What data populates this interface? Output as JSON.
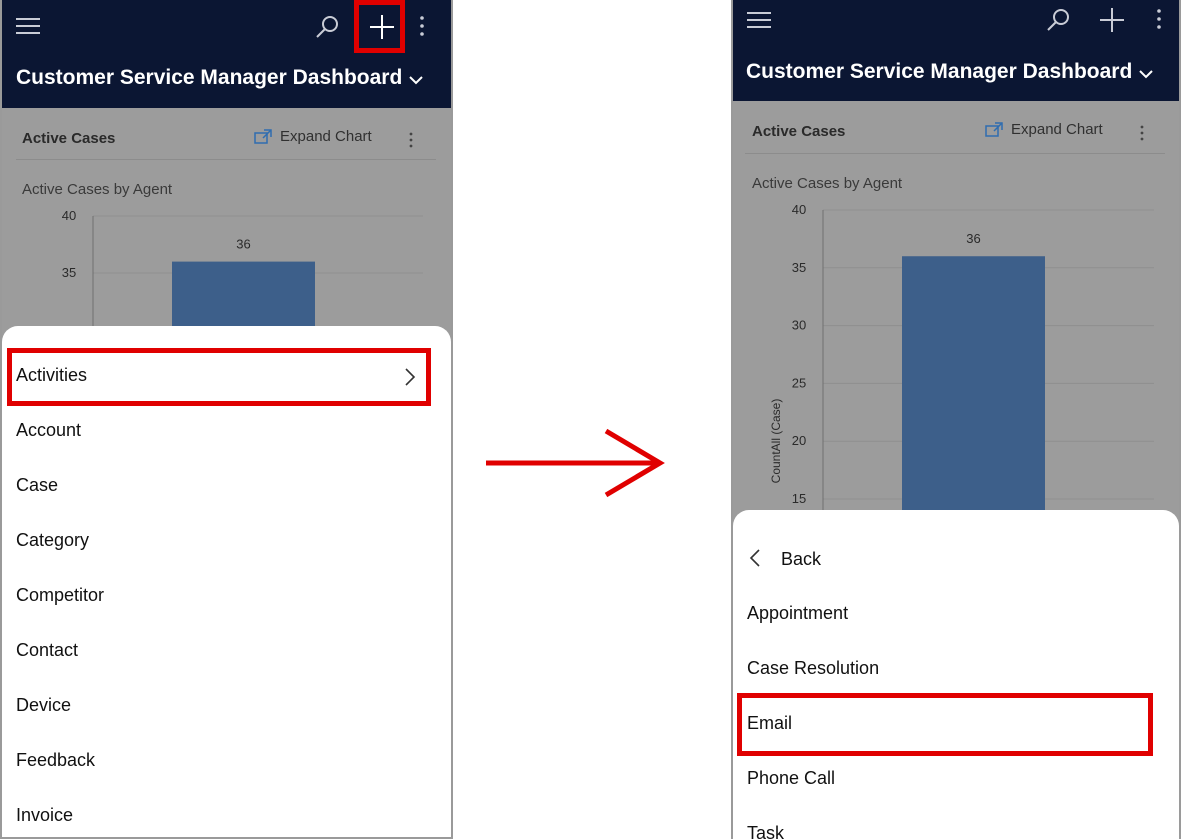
{
  "left_screen": {
    "dashboard_title": "Customer Service Manager Dashboard",
    "card_title": "Active Cases",
    "expand_chart_label": "Expand Chart",
    "chart_caption": "Active Cases by Agent",
    "menu": {
      "items": [
        {
          "label": "Activities",
          "has_submenu": true
        },
        {
          "label": "Account"
        },
        {
          "label": "Case"
        },
        {
          "label": "Category"
        },
        {
          "label": "Competitor"
        },
        {
          "label": "Contact"
        },
        {
          "label": "Device"
        },
        {
          "label": "Feedback"
        },
        {
          "label": "Invoice"
        }
      ]
    },
    "chart_data": {
      "type": "bar",
      "categories": [
        ""
      ],
      "values": [
        36
      ],
      "ylim": [
        33,
        40
      ],
      "yticks": [
        "35",
        "40"
      ],
      "data_labels": [
        "36"
      ],
      "bar_color": "#3d5f8a"
    }
  },
  "right_screen": {
    "dashboard_title": "Customer Service Manager Dashboard",
    "card_title": "Active Cases",
    "expand_chart_label": "Expand Chart",
    "chart_caption": "Active Cases by Agent",
    "menu": {
      "back_label": "Back",
      "items": [
        {
          "label": "Appointment"
        },
        {
          "label": "Case Resolution"
        },
        {
          "label": "Email"
        },
        {
          "label": "Phone Call"
        },
        {
          "label": "Task"
        }
      ]
    },
    "chart_data": {
      "type": "bar",
      "categories": [
        ""
      ],
      "values": [
        36
      ],
      "ylim": [
        14,
        40
      ],
      "yticks": [
        "40",
        "35",
        "30",
        "25",
        "20",
        "15"
      ],
      "ylabel": "CountAll (Case)",
      "data_labels": [
        "36"
      ],
      "bar_color": "#3d5f8a"
    }
  },
  "colors": {
    "header_bg": "#0b1633",
    "highlight": "#e00000",
    "overlay": "#9c9c9c"
  },
  "icons": [
    "hamburger-icon",
    "search-icon",
    "plus-icon",
    "more-vertical-icon",
    "chevron-down-icon",
    "expand-chart-icon",
    "chevron-right-icon",
    "chevron-left-icon",
    "arrow-right-icon"
  ]
}
